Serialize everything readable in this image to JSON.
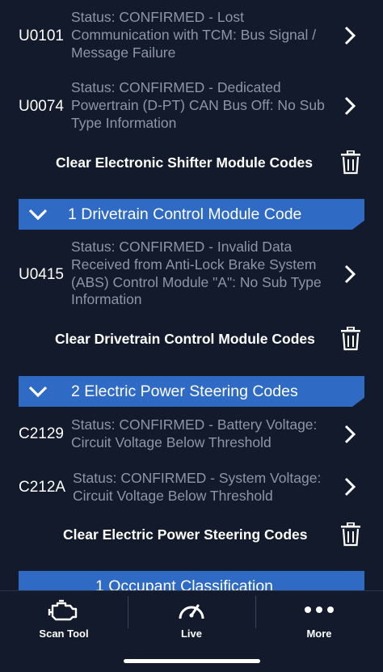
{
  "groups": [
    {
      "codes": [
        {
          "code": "U0101",
          "status": "Status: CONFIRMED - Lost Communication with TCM: Bus Signal / Message Failure"
        },
        {
          "code": "U0074",
          "status": "Status: CONFIRMED - Dedicated Powertrain (D-PT) CAN Bus Off: No Sub Type Information"
        }
      ],
      "clear_label": "Clear Electronic Shifter Module Codes"
    },
    {
      "header": "1 Drivetrain Control Module Code",
      "codes": [
        {
          "code": "U0415",
          "status": "Status: CONFIRMED - Invalid Data Received from Anti-Lock Brake System (ABS) Control Module \"A\": No Sub Type Information"
        }
      ],
      "clear_label": "Clear Drivetrain Control Module Codes"
    },
    {
      "header": "2 Electric Power Steering Codes",
      "codes": [
        {
          "code": "C2129",
          "status": "Status: CONFIRMED - Battery Voltage: Circuit Voltage Below Threshold"
        },
        {
          "code": "C212A",
          "status": "Status: CONFIRMED - System Voltage: Circuit Voltage Below Threshold"
        }
      ],
      "clear_label": "Clear Electric Power Steering Codes"
    },
    {
      "header": "1 Occupant Classification"
    }
  ],
  "tabs": [
    {
      "label": "Scan Tool",
      "icon": "engine-icon"
    },
    {
      "label": "Live",
      "icon": "gauge-icon"
    },
    {
      "label": "More",
      "icon": "more-dots-icon"
    }
  ],
  "colors": {
    "background": "#121a2b",
    "section": "#2f6bc5",
    "status_text": "#8e95a4"
  }
}
